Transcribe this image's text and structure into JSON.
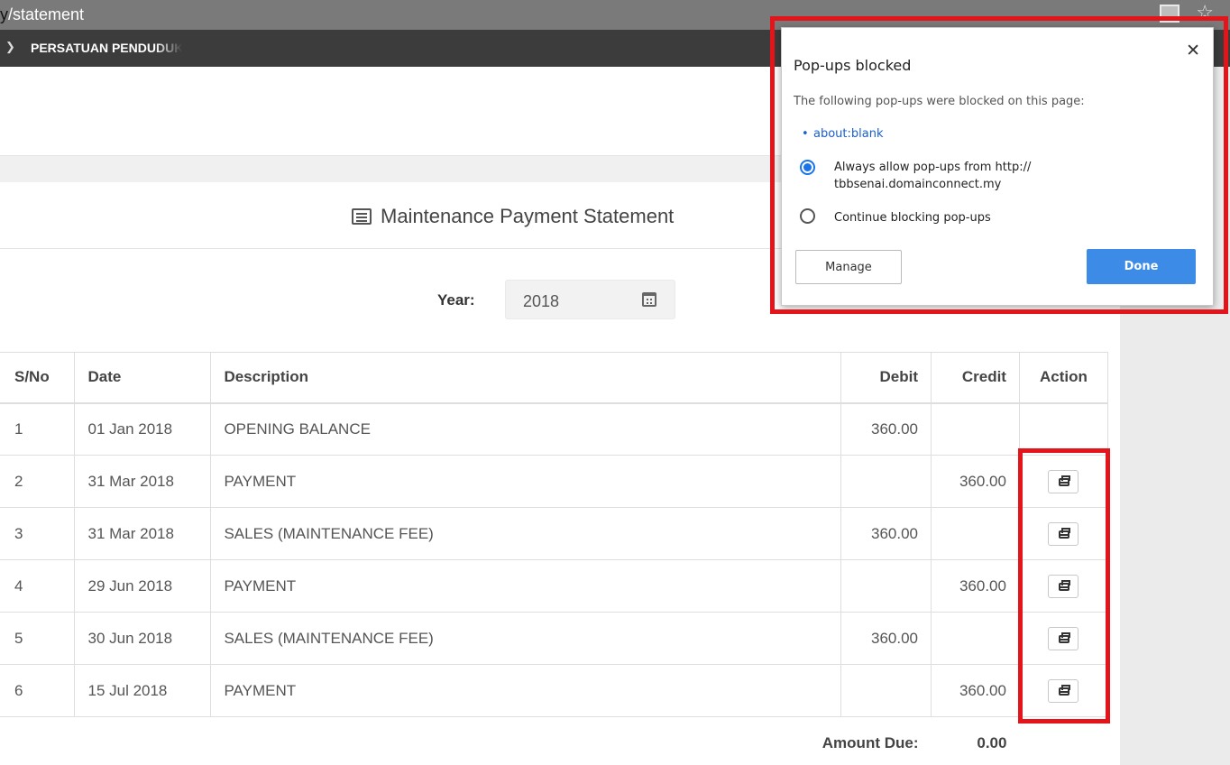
{
  "browser": {
    "url_prefix": "y",
    "url_path": "/statement",
    "bookmark_label": "PERSATUAN PENDUDUK"
  },
  "page": {
    "title": "Maintenance Payment Statement",
    "year_label": "Year:",
    "year_value": "2018"
  },
  "table": {
    "headers": {
      "sno": "S/No",
      "date": "Date",
      "description": "Description",
      "debit": "Debit",
      "credit": "Credit",
      "action": "Action"
    },
    "rows": [
      {
        "sno": "1",
        "date": "01 Jan 2018",
        "description": "OPENING BALANCE",
        "debit": "360.00",
        "credit": ""
      },
      {
        "sno": "2",
        "date": "31 Mar 2018",
        "description": "PAYMENT",
        "debit": "",
        "credit": "360.00"
      },
      {
        "sno": "3",
        "date": "31 Mar 2018",
        "description": "SALES (MAINTENANCE FEE)",
        "debit": "360.00",
        "credit": ""
      },
      {
        "sno": "4",
        "date": "29 Jun 2018",
        "description": "PAYMENT",
        "debit": "",
        "credit": "360.00"
      },
      {
        "sno": "5",
        "date": "30 Jun 2018",
        "description": "SALES (MAINTENANCE FEE)",
        "debit": "360.00",
        "credit": ""
      },
      {
        "sno": "6",
        "date": "15 Jul 2018",
        "description": "PAYMENT",
        "debit": "",
        "credit": "360.00"
      }
    ],
    "amount_due_label": "Amount Due:",
    "amount_due_value": "0.00"
  },
  "popup": {
    "title": "Pop-ups blocked",
    "description": "The following pop-ups were blocked on this page:",
    "blocked_link": "about:blank",
    "option_allow_line1": "Always allow pop-ups from http://",
    "option_allow_line2": "tbbsenai.domainconnect.my",
    "option_block": "Continue blocking pop-ups",
    "selected_option": "allow",
    "manage_label": "Manage",
    "done_label": "Done"
  },
  "colors": {
    "highlight_red": "#e4141b",
    "done_blue": "#3c8be6",
    "radio_blue": "#1a73e8"
  }
}
